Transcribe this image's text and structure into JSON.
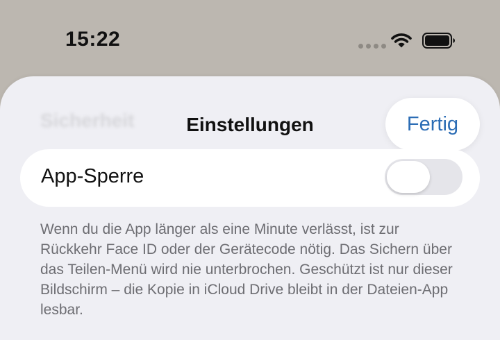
{
  "status_bar": {
    "time": "15:22",
    "icons": [
      "cellular-icon",
      "wifi-icon",
      "battery-icon"
    ]
  },
  "sheet": {
    "background_title": "Sicherheit",
    "title": "Einstellungen",
    "done_label": "Fertig",
    "toggle": {
      "label": "App-Sperre",
      "on": false
    },
    "footnote": "Wenn du die App länger als eine Minute verlässt, ist zur Rückkehr Face ID oder der Gerätecode nötig. Das Sichern über das Teilen-Menü wird nie unterbrochen. Geschützt ist nur dieser Bildschirm – die Kopie in iCloud Drive bleibt in der Dateien-App lesbar."
  },
  "colors": {
    "accent": "#2c6db5",
    "sheet_background": "#efeff4",
    "toggle_off": "#e5e5ea"
  }
}
